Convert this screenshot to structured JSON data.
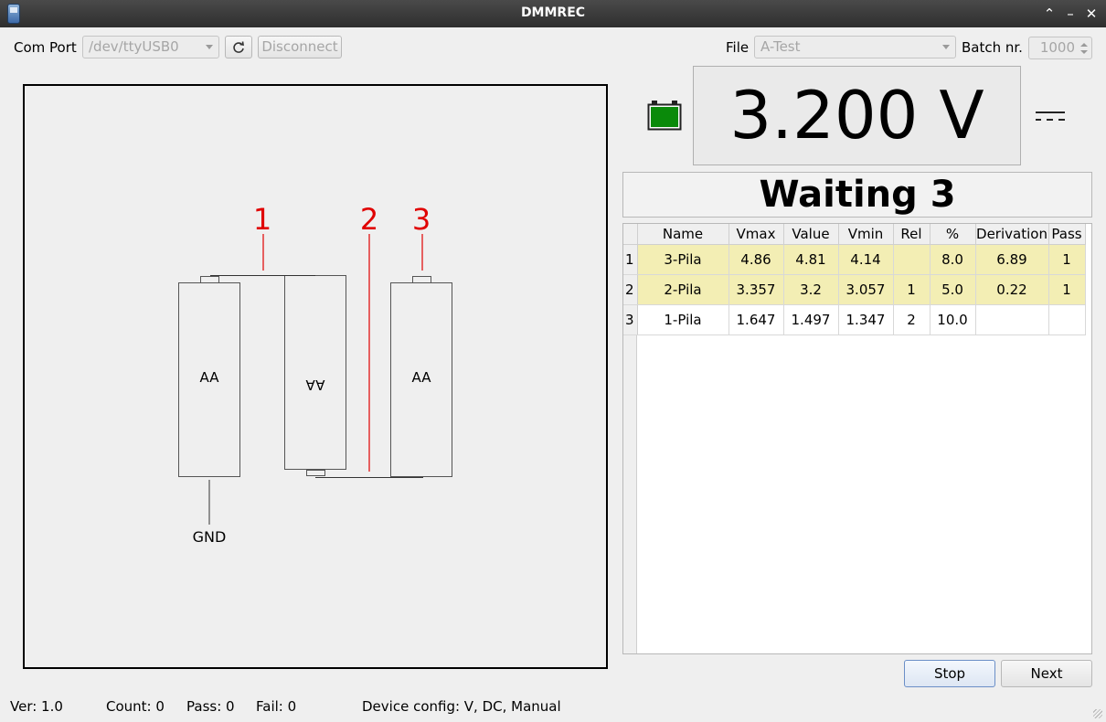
{
  "window": {
    "title": "DMMREC"
  },
  "toolbar": {
    "com_port_label": "Com Port",
    "com_port_value": "/dev/ttyUSB0",
    "disconnect_label": "Disconnect",
    "file_label": "File",
    "file_value": "A-Test",
    "batch_label": "Batch nr.",
    "batch_value": "1000"
  },
  "diagram": {
    "batteries": [
      "AA",
      "AA",
      "AA"
    ],
    "probe_labels": [
      "1",
      "2",
      "3"
    ],
    "gnd_label": "GND",
    "probe_color": "#e00000"
  },
  "meter": {
    "reading": "3.200 V",
    "status": "Waiting 3",
    "battery_color": "#0a8a0a"
  },
  "table": {
    "headers": [
      "Name",
      "Vmax",
      "Value",
      "Vmin",
      "Rel",
      "%",
      "Derivation",
      "Pass"
    ],
    "rows": [
      {
        "index": "1",
        "cells": [
          "3-Pila",
          "4.86",
          "4.81",
          "4.14",
          "",
          "8.0",
          "6.89",
          "1"
        ]
      },
      {
        "index": "2",
        "cells": [
          "2-Pila",
          "3.357",
          "3.2",
          "3.057",
          "1",
          "5.0",
          "0.22",
          "1"
        ]
      },
      {
        "index": "3",
        "cells": [
          "1-Pila",
          "1.647",
          "1.497",
          "1.347",
          "2",
          "10.0",
          "",
          ""
        ]
      }
    ],
    "highlight_color": "#f3eeb4"
  },
  "buttons": {
    "stop": "Stop",
    "next": "Next"
  },
  "footer": {
    "version": "Ver: 1.0",
    "count": "Count: 0",
    "pass": "Pass: 0",
    "fail": "Fail: 0",
    "device_config": "Device config: V, DC, Manual"
  }
}
